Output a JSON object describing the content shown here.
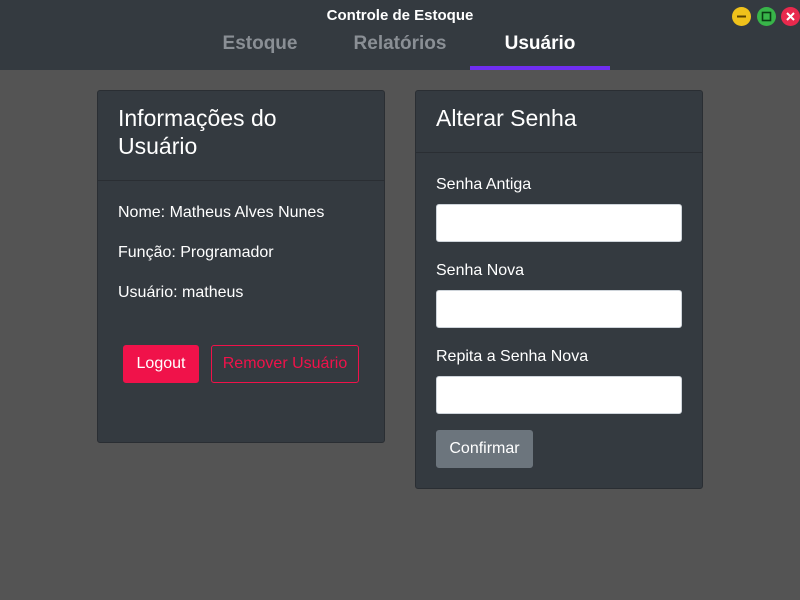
{
  "window": {
    "title": "Controle de Estoque",
    "controls": {
      "minimize": "minimize-icon",
      "maximize": "maximize-icon",
      "close": "close-icon"
    }
  },
  "tabs": [
    {
      "label": "Estoque",
      "active": false
    },
    {
      "label": "Relatórios",
      "active": false
    },
    {
      "label": "Usuário",
      "active": true
    }
  ],
  "user_info": {
    "title": "Informações do Usuário",
    "name_line": "Nome: Matheus Alves Nunes",
    "role_line": "Função: Programador",
    "username_line": "Usuário: matheus",
    "logout_label": "Logout",
    "remove_label": "Remover Usuário"
  },
  "change_password": {
    "title": "Alterar Senha",
    "old_label": "Senha Antiga",
    "old_value": "",
    "new_label": "Senha Nova",
    "new_value": "",
    "repeat_label": "Repita a Senha Nova",
    "repeat_value": "",
    "confirm_label": "Confirmar"
  },
  "colors": {
    "background": "#545454",
    "panel": "#343a40",
    "active_tab_underline": "#6f2ef0",
    "danger": "#f0124a",
    "secondary": "#6c757d"
  }
}
